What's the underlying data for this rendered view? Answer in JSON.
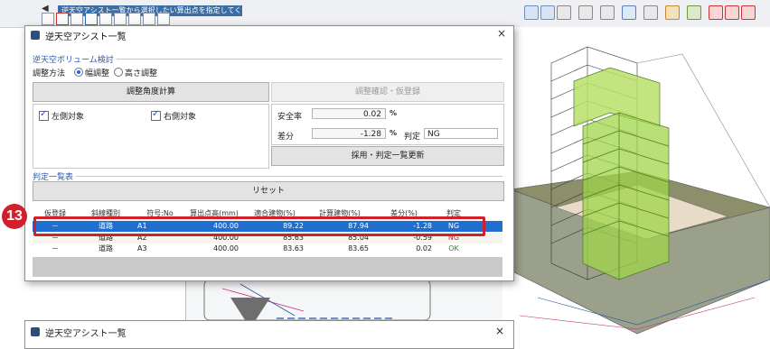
{
  "status_message": "逆天空アシスト一覧から選択したい算出点を指定してください。",
  "dialog": {
    "title": "逆天空アシスト一覧",
    "close_symbol": "×",
    "volume_group": "逆天空ボリューム検討",
    "adjust_method_label": "調整方法",
    "radio_width": "幅調整",
    "radio_height": "高さ調整",
    "calc_button": "調整角度計算",
    "confirm_button": "調整確認・仮登録",
    "left_target": "左側対象",
    "right_target": "右側対象",
    "safety_label": "安全率",
    "safety_value": "0.02",
    "diff_label": "差分",
    "diff_value": "-1.28",
    "unit_percent": "%",
    "judge_label": "判定",
    "judge_value": "NG",
    "adopt_button": "採用・判定一覧更新",
    "judge_list_group": "判定一覧表",
    "reset_button": "リセット"
  },
  "table": {
    "headers": [
      "仮登録",
      "斜線種別",
      "符号:No",
      "算出点高(mm)",
      "適合建物(%)",
      "計算建物(%)",
      "差分(%)",
      "判定"
    ],
    "rows": [
      [
        "－",
        "道路",
        "A1",
        "400.00",
        "89.22",
        "87.94",
        "-1.28",
        "NG"
      ],
      [
        "－",
        "道路",
        "A2",
        "400.00",
        "85.63",
        "85.04",
        "-0.59",
        "NG"
      ],
      [
        "－",
        "道路",
        "A3",
        "400.00",
        "83.63",
        "83.65",
        "0.02",
        "OK"
      ]
    ]
  },
  "step_badge": "13",
  "dialog2": {
    "title": "逆天空アシスト一覧",
    "close_symbol": "×"
  },
  "colors": {
    "accent_blue": "#1f6fd1",
    "highlight_red": "#d11f2b",
    "ok_green": "#2e8b2e",
    "ng_red": "#d11f2b",
    "building_green": "#9fd64a"
  }
}
